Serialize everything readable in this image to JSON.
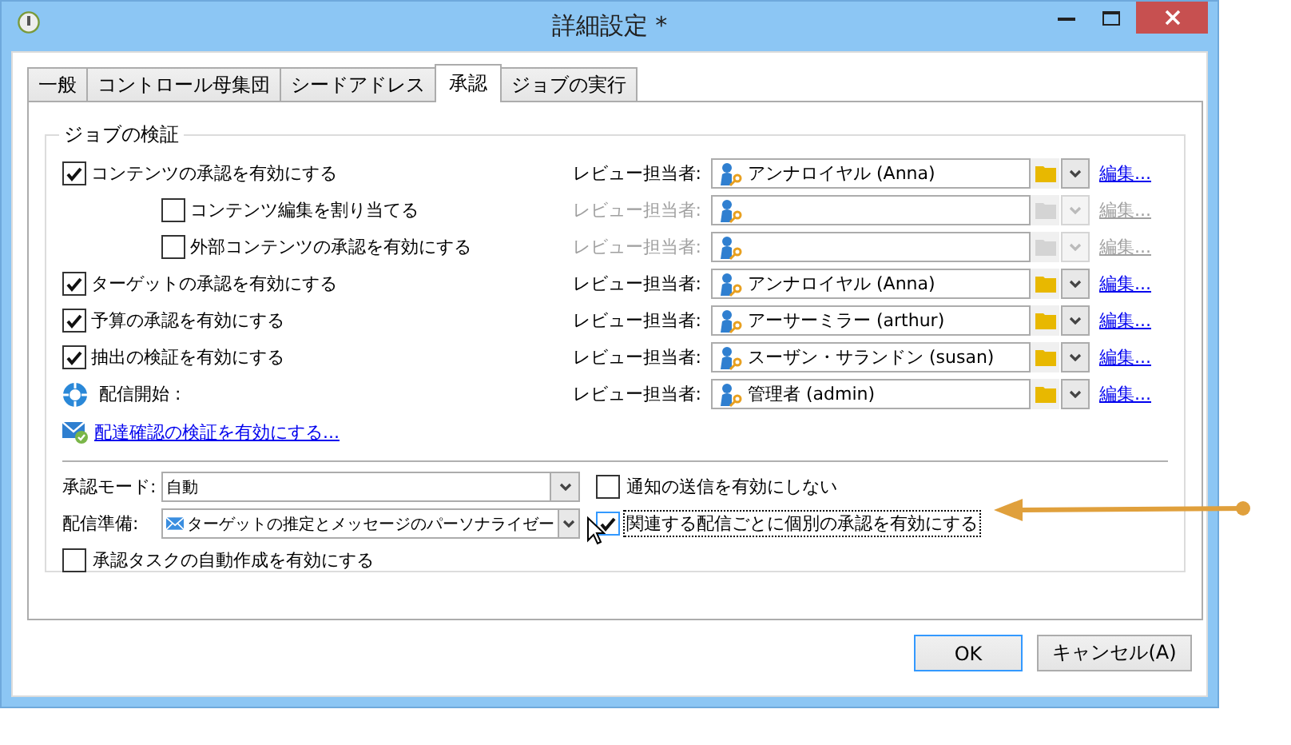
{
  "window": {
    "title": "詳細設定 *"
  },
  "tabs": [
    {
      "label": "一般",
      "selected": false
    },
    {
      "label": "コントロール母集団",
      "selected": false
    },
    {
      "label": "シードアドレス",
      "selected": false
    },
    {
      "label": "承認",
      "selected": true
    },
    {
      "label": "ジョブの実行",
      "selected": false
    }
  ],
  "group": {
    "title": "ジョブの検証",
    "rows": [
      {
        "kind": "checkbox",
        "label": "コンテンツの承認を有効にする",
        "checked": true,
        "reviewer": {
          "label": "レビュー担当者:",
          "value": "アンナロイヤル (Anna)",
          "disabled": false,
          "link": "編集..."
        },
        "children": [
          {
            "kind": "checkbox",
            "label": "コンテンツ編集を割り当てる",
            "checked": false,
            "reviewer": {
              "label": "レビュー担当者:",
              "disabled": true,
              "link": "編集..."
            }
          },
          {
            "kind": "checkbox",
            "label": "外部コンテンツの承認を有効にする",
            "checked": false,
            "reviewer": {
              "label": "レビュー担当者:",
              "disabled": true,
              "link": "編集..."
            }
          }
        ]
      },
      {
        "kind": "checkbox",
        "label": "ターゲットの承認を有効にする",
        "checked": true,
        "reviewer": {
          "label": "レビュー担当者:",
          "value": "アンナロイヤル (Anna)",
          "disabled": false,
          "link": "編集..."
        }
      },
      {
        "kind": "checkbox",
        "label": "予算の承認を有効にする",
        "checked": true,
        "reviewer": {
          "label": "レビュー担当者:",
          "value": "アーサーミラー (arthur)",
          "disabled": false,
          "link": "編集..."
        }
      },
      {
        "kind": "checkbox",
        "label": "抽出の検証を有効にする",
        "checked": true,
        "reviewer": {
          "label": "レビュー担当者:",
          "value": "スーザン・サランドン (susan)",
          "disabled": false,
          "link": "編集..."
        }
      },
      {
        "kind": "status",
        "label": "配信開始 :",
        "reviewer": {
          "label": "レビュー担当者:",
          "value": "管理者 (admin)",
          "disabled": false,
          "link": "編集..."
        }
      }
    ],
    "link": "配達確認の検証を有効にする...",
    "fields": [
      {
        "kind": "plain",
        "label": "承認モード:",
        "value": "自動",
        "option": {
          "label": "通知の送信を有効にしない",
          "checked": false,
          "focused": false
        }
      },
      {
        "kind": "message",
        "label": "配信準備:",
        "value": "ターゲットの推定とメッセージのパーソナライゼー",
        "option": {
          "label": "関連する配信ごとに個別の承認を有効にする",
          "checked": true,
          "focused": true
        }
      }
    ],
    "option": {
      "label": "承認タスクの自動作成を有効にする",
      "checked": false,
      "focused": false
    }
  },
  "buttons": [
    {
      "label": "OK",
      "default": true
    },
    {
      "label": "キャンセル(A)",
      "default": false
    }
  ]
}
